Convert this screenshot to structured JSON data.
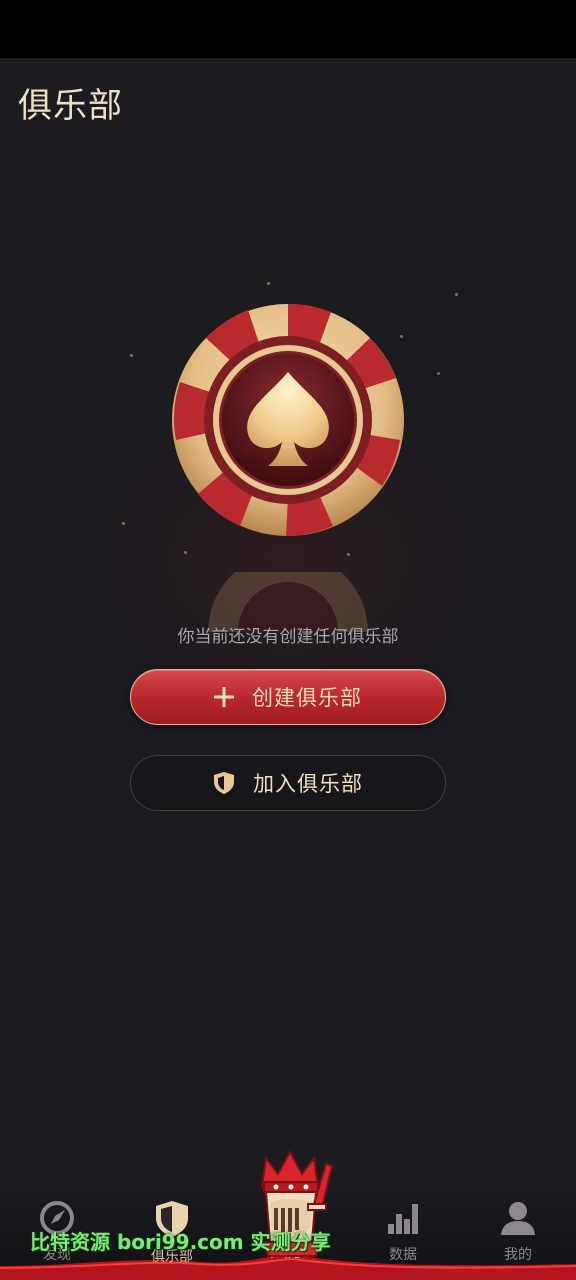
{
  "header": {
    "title": "俱乐部"
  },
  "empty_state": {
    "message": "你当前还没有创建任何俱乐部"
  },
  "actions": {
    "create_label": "创建俱乐部",
    "join_label": "加入俱乐部"
  },
  "tabbar": {
    "items": [
      {
        "label": "发现",
        "icon": "compass-icon",
        "active": false
      },
      {
        "label": "俱乐部",
        "icon": "shield-icon",
        "active": true
      },
      {
        "label": "大厅",
        "icon": "king-mascot-icon",
        "active": false
      },
      {
        "label": "数据",
        "icon": "bar-chart-icon",
        "active": false
      },
      {
        "label": "我的",
        "icon": "user-icon",
        "active": false
      }
    ]
  },
  "watermark": {
    "text": "比特资源 bori99.com 实测分享"
  },
  "colors": {
    "background": "#1c1b20",
    "accent_red": "#b7262c",
    "gold": "#efe0c4"
  }
}
